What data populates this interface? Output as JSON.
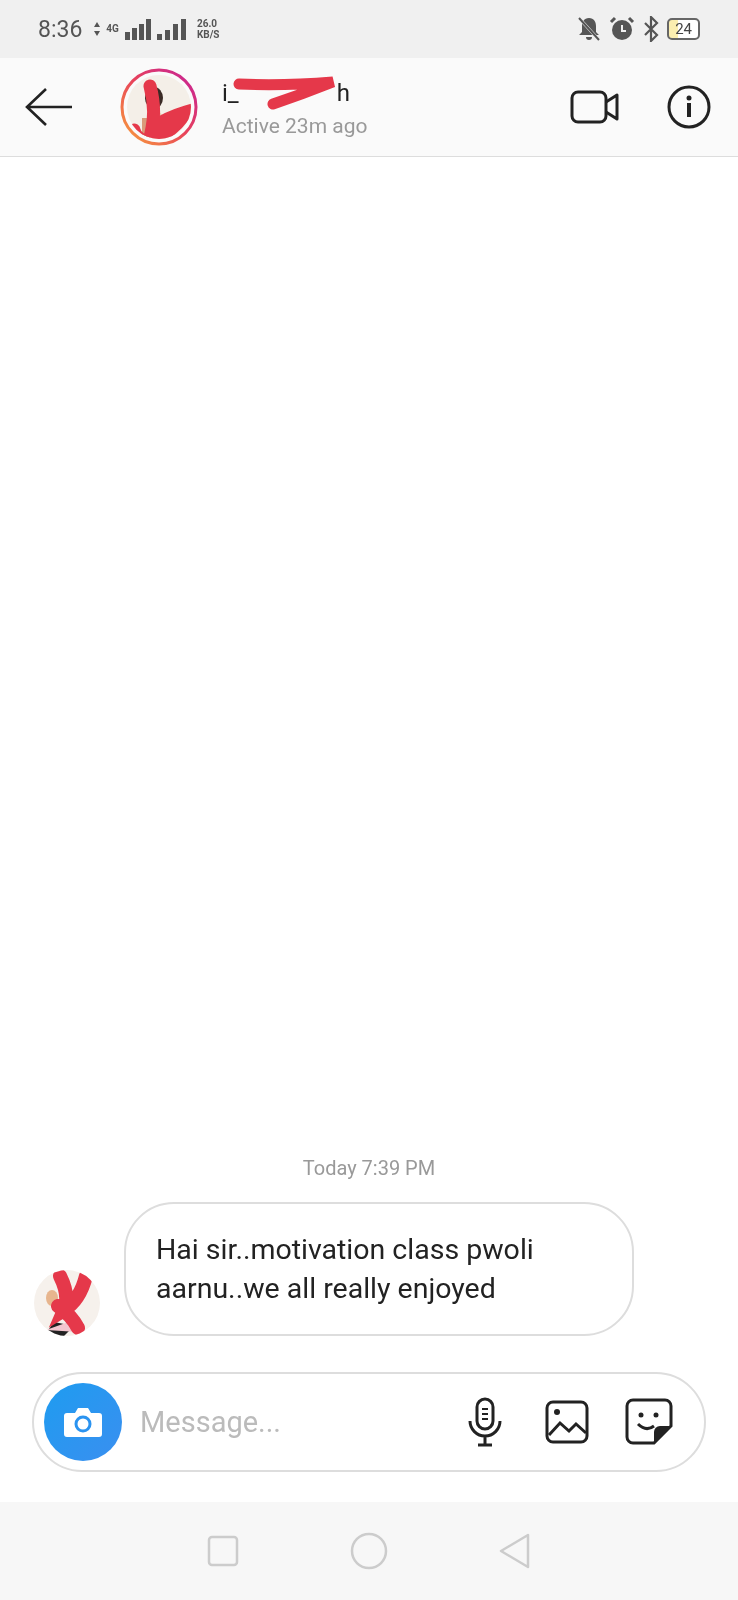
{
  "status_bar": {
    "time": "8:36",
    "network_type": "4G",
    "speed_value": "26.0",
    "speed_unit": "KB/S",
    "battery": "24"
  },
  "header": {
    "username_start": "i_",
    "username_end": "h",
    "status": "Active 23m ago"
  },
  "conversation": {
    "timestamp": "Today 7:39 PM",
    "messages": [
      {
        "kind": "received",
        "text": "Hai sir..motivation class pwoli aarnu..we all really enjoyed"
      }
    ]
  },
  "composer": {
    "placeholder": "Message..."
  }
}
